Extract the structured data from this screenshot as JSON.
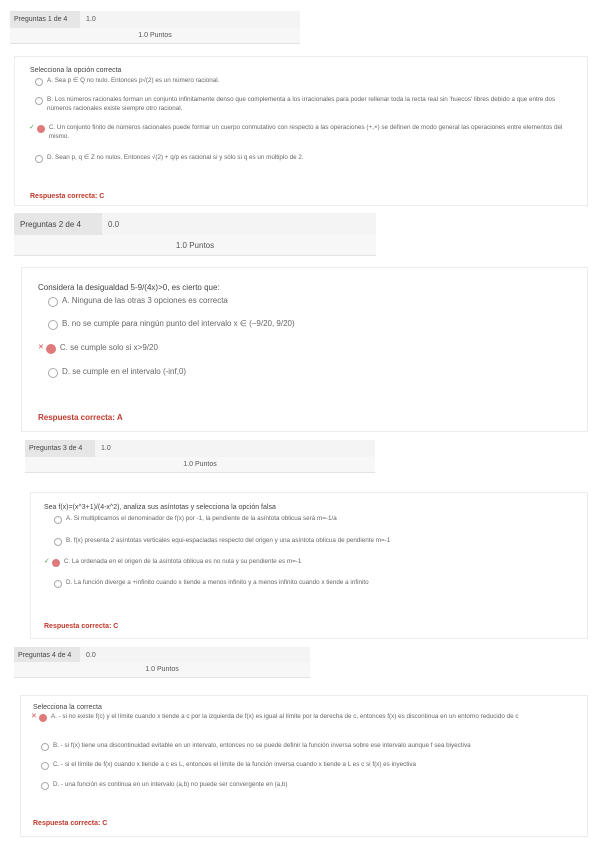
{
  "questions": [
    {
      "header": "Preguntas 1 de 4",
      "score": "1.0",
      "points": "1.0 Puntos",
      "prompt": "Selecciona la opción correcta",
      "options": [
        {
          "text": "A. Sea p ∈ Q no nulo. Entonces p√(2) es un número racional.",
          "mark": ""
        },
        {
          "text": "B. Los números racionales forman un conjunto infinitamente denso que complementa a los irracionales para poder rellenar toda la recta real sin 'huecos' libres debido a que entre dos números racionales existe siempre otro racional.",
          "mark": ""
        },
        {
          "text": "C. Un conjunto finito de números racionales puede formar un cuerpo conmutativo con respecto a las operaciones (+,×) se definen de modo general las operaciones entre elementos del mismo.",
          "mark": "ok"
        },
        {
          "text": "D. Sean p, q ∈ Z no nulos. Entonces √(2) + q/p es racional si y sólo si q es un múltiplo de 2.",
          "mark": ""
        }
      ],
      "answer": "Respuesta correcta: C"
    },
    {
      "header": "Preguntas 2 de 4",
      "score": "0.0",
      "points": "1.0 Puntos",
      "prompt": "Considera la desigualdad 5-9/(4x)>0, es cierto que:",
      "options": [
        {
          "text": "A. Ninguna de las otras 3 opciones es correcta",
          "mark": ""
        },
        {
          "text": "B. no se cumple para ningún punto del intervalo x ∈ (−9/20, 9/20)",
          "mark": ""
        },
        {
          "text": "C. se cumple solo si x>9/20",
          "mark": "bad"
        },
        {
          "text": "D. se cumple en el intervalo (-inf,0)",
          "mark": ""
        }
      ],
      "answer": "Respuesta correcta: A"
    },
    {
      "header": "Preguntas 3 de 4",
      "score": "1.0",
      "points": "1.0 Puntos",
      "prompt": "Sea f(x)=(x^3+1)/(4-x^2), analiza sus asíntotas y selecciona la opción falsa",
      "options": [
        {
          "text": "A. Si multiplicamos el denominador de f(x) por -1, la pendiente de la asíntota oblicua será m=-1/a",
          "mark": ""
        },
        {
          "text": "B. f(x) presenta 2 asíntotas verticales equi-espaciadas respecto del origen y una asíntota oblicua de pendiente m=-1",
          "mark": ""
        },
        {
          "text": "C. La ordenada en el origen de la asíntota oblicua es no nula y su pendiente es m=-1",
          "mark": "ok"
        },
        {
          "text": "D. La función diverge a +infinito cuando x tiende a menos infinito y a menos infinito cuando x tiende a infinito",
          "mark": ""
        }
      ],
      "answer": "Respuesta correcta: C"
    },
    {
      "header": "Preguntas 4 de 4",
      "score": "0.0",
      "points": "1.0 Puntos",
      "prompt": "Selecciona la correcta",
      "options": [
        {
          "text": "A. - si no existe f(c) y el límite cuando x tiende a c por la izquierda de f(x) es igual al límite por la derecha de c, entonces f(x) es discontinua en un entorno reducido de c",
          "mark": "bad"
        },
        {
          "text": "B. - si f(x) tiene una discontinuidad evitable en un intervalo, entonces no se puede definir la función inversa sobre ese intervalo aunque f sea biyectiva",
          "mark": ""
        },
        {
          "text": "C. - si el límite de f(x) cuando x tiende a c es L, entonces el límite de la función inversa cuando x tiende a L es c si f(x) es inyectiva",
          "mark": ""
        },
        {
          "text": "D. - una función es continua en un intervalo (a,b) no puede ser convergente en (a,b)",
          "mark": ""
        }
      ],
      "answer": "Respuesta correcta: C"
    }
  ]
}
